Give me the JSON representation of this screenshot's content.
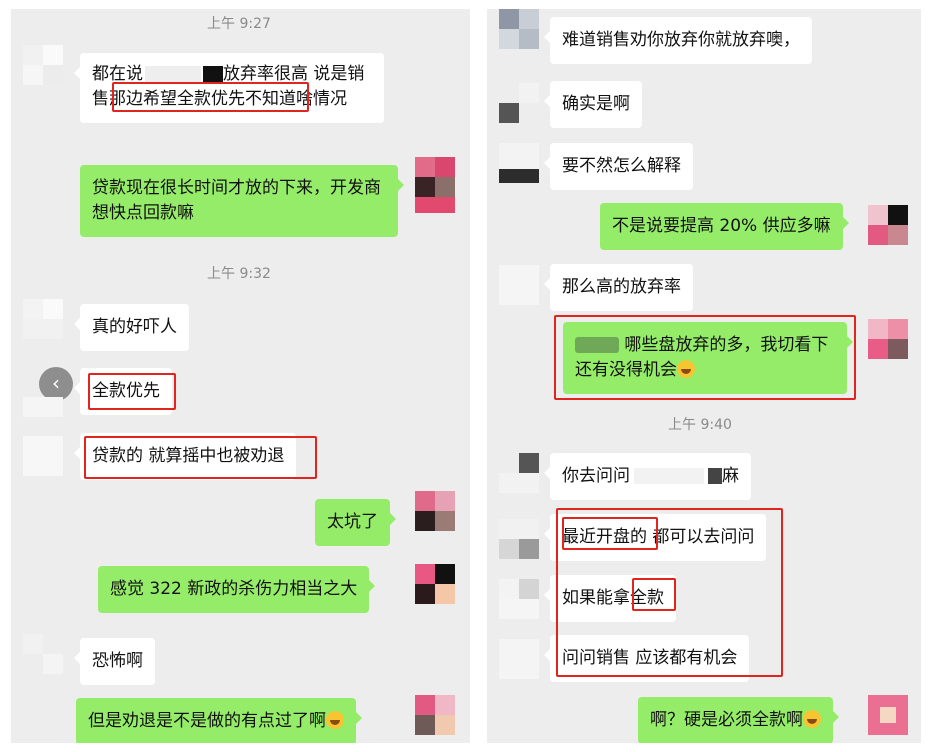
{
  "left": {
    "time1": "上午 9:27",
    "time2": "上午 9:32",
    "back_glyph": "‹",
    "m1_p1": "都在说",
    "m1_p2": "放弃率很高 说是",
    "m1_p3": "销售那边希望全款优先",
    "m1_p4": "不知道啥情况",
    "m2": "贷款现在很长时间才放的下来，开发商想快点回款嘛",
    "m3": "真的好吓人",
    "m4": "全款优先",
    "m5": "贷款的 就算摇中也被劝退",
    "m6": "太坑了",
    "m7": "感觉 322 新政的杀伤力相当之大",
    "m8": "恐怖啊",
    "m9": "但是劝退是不是做的有点过了啊"
  },
  "right": {
    "time1": "上午 9:40",
    "r1": "难道销售劝你放弃你就放弃噢，",
    "r2": "确实是啊",
    "r3": "要不然怎么解释",
    "r4": "不是说要提高 20% 供应多嘛",
    "r5": "那么高的放弃率",
    "r6": "哪些盘放弃的多，我切看下还有没得机会",
    "r7_p1": "你去问问",
    "r7_p2": "麻",
    "r8_p1": "最近开盘的",
    "r8_p2": " 都可以去问问",
    "r9_p1": "如果能拿",
    "r9_p2": "全款",
    "r10": "问问销售 应该都有机会",
    "r11": "啊？硬是必须全款啊"
  },
  "colors": {
    "background": "#ededed",
    "bubble_sent": "#95ec69",
    "bubble_received": "#ffffff",
    "highlight": "#e0241e"
  },
  "icons": {
    "back": "chevron-left-icon",
    "emoji": "laugh-emoji-icon"
  }
}
